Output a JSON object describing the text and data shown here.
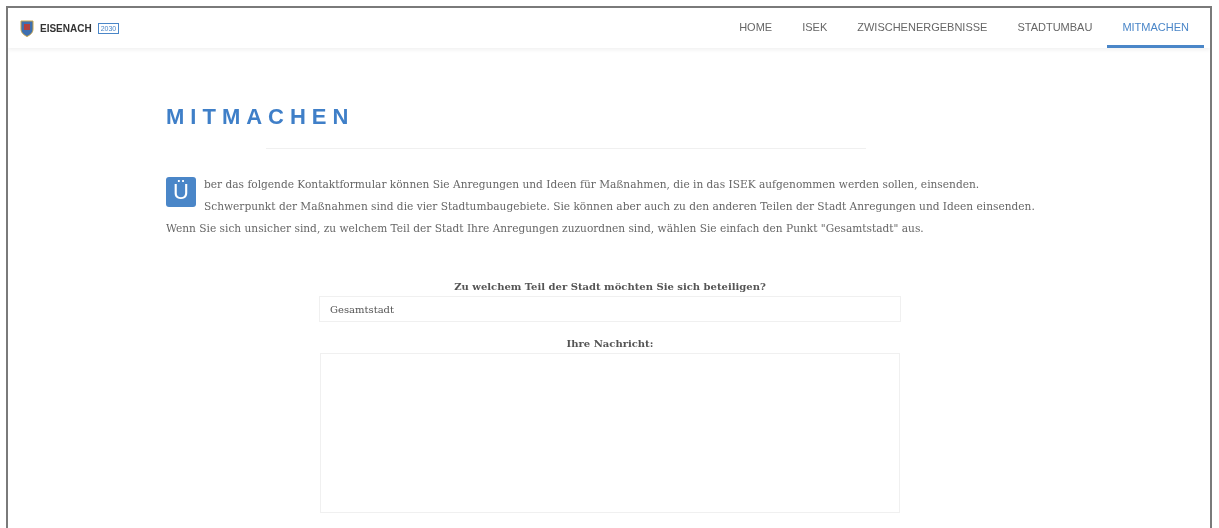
{
  "header": {
    "logo_text": "EISENACH",
    "logo_badge": "2030"
  },
  "nav": [
    {
      "label": "HOME",
      "selected": false
    },
    {
      "label": "ISEK",
      "selected": false
    },
    {
      "label": "ZWISCHENERGEBNISSE",
      "selected": false
    },
    {
      "label": "STADTUMBAU",
      "selected": false
    },
    {
      "label": "MITMACHEN",
      "selected": true
    }
  ],
  "page_title": "MITMACHEN",
  "intro": {
    "initial": "Ü",
    "text": "ber das folgende Kontaktformular können Sie Anregungen und Ideen für Maßnahmen, die in das ISEK aufgenommen werden sollen, einsenden. Schwerpunkt der Maßnahmen sind die vier Stadtumbaugebiete. Sie können aber auch zu den anderen Teilen der Stadt Anregungen und Ideen einsenden. Wenn Sie sich unsicher sind, zu welchem Teil der Stadt Ihre Anregungen zuzuordnen sind, wählen Sie einfach den Punkt \"Gesamtstadt\" aus."
  },
  "form": {
    "area_label": "Zu welchem Teil der Stadt möchten Sie sich beteiligen?",
    "area_value": "Gesamtstadt",
    "message_label": "Ihre Nachricht:"
  }
}
